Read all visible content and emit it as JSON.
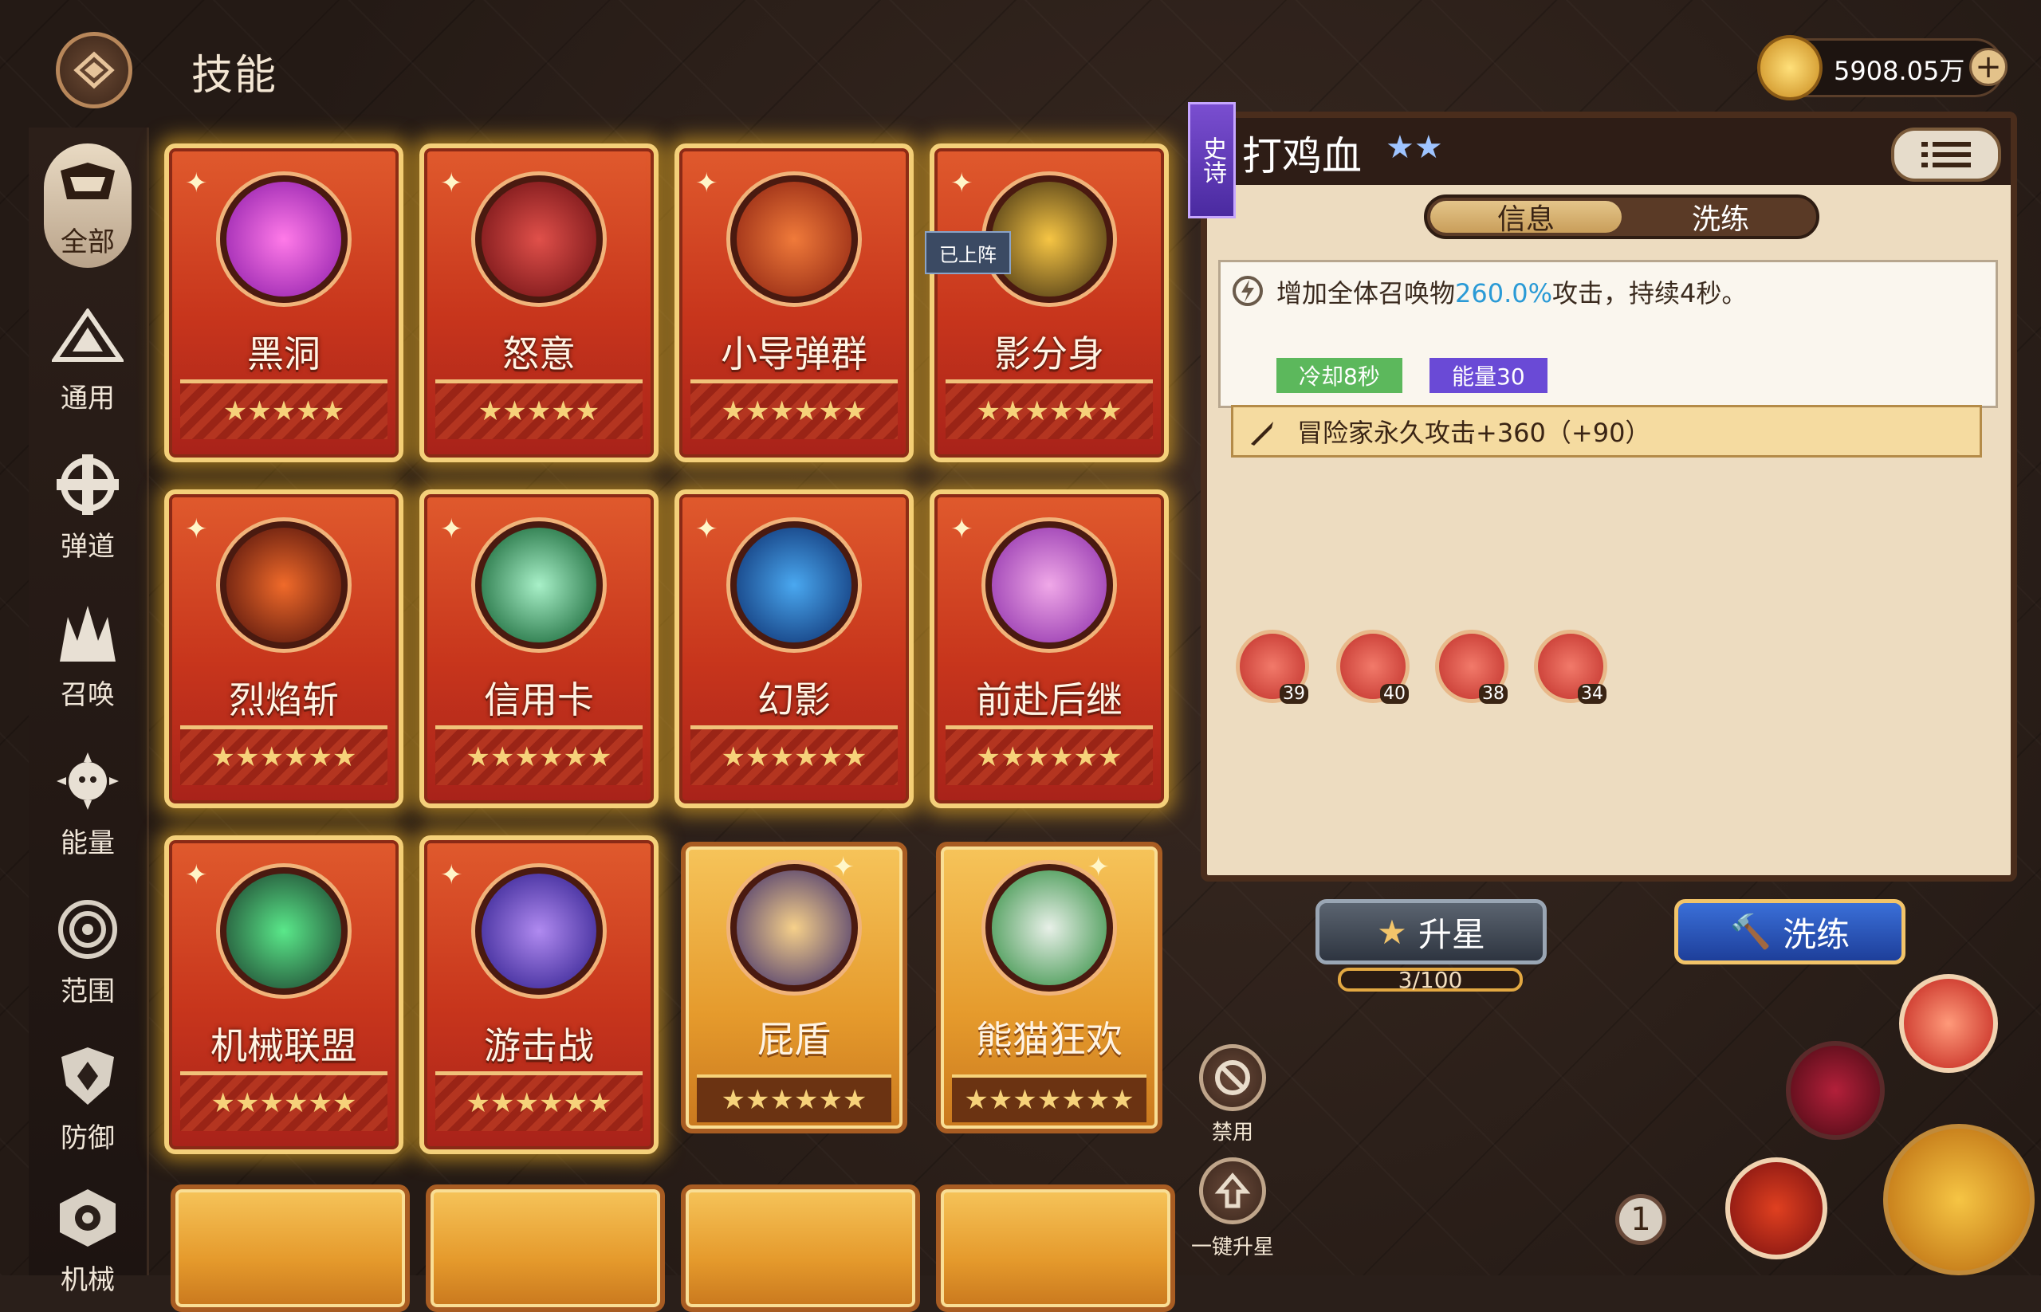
{
  "header": {
    "title": "技能"
  },
  "currency": {
    "value": "5908.05万",
    "plus": "+"
  },
  "sidebar": {
    "items": [
      {
        "label": "全部"
      },
      {
        "label": "通用"
      },
      {
        "label": "弹道"
      },
      {
        "label": "召唤"
      },
      {
        "label": "能量"
      },
      {
        "label": "范围"
      },
      {
        "label": "防御"
      },
      {
        "label": "机械"
      }
    ]
  },
  "cards": [
    {
      "name": "黑洞",
      "stars": "★★★★★",
      "style": "red"
    },
    {
      "name": "怒意",
      "stars": "★★★★★",
      "style": "red"
    },
    {
      "name": "小导弹群",
      "stars": "★★★★★★",
      "style": "red"
    },
    {
      "name": "影分身",
      "stars": "★★★★★★",
      "style": "red"
    },
    {
      "name": "烈焰斩",
      "stars": "★★★★★★",
      "style": "red"
    },
    {
      "name": "信用卡",
      "stars": "★★★★★★",
      "style": "red"
    },
    {
      "name": "幻影",
      "stars": "★★★★★★",
      "style": "red"
    },
    {
      "name": "前赴后继",
      "stars": "★★★★★★",
      "style": "red"
    },
    {
      "name": "机械联盟",
      "stars": "★★★★★★",
      "style": "red"
    },
    {
      "name": "游击战",
      "stars": "★★★★★★",
      "style": "red"
    },
    {
      "name": "屁盾",
      "stars": "★★★★★★",
      "style": "gold"
    },
    {
      "name": "熊猫狂欢",
      "stars": "★★★★★★★",
      "style": "gold"
    }
  ],
  "deployed_tag": "已上阵",
  "detail": {
    "rarity": "史诗",
    "name": "打鸡血",
    "stars": "★★",
    "tabs": [
      {
        "label": "信息"
      },
      {
        "label": "洗练"
      }
    ],
    "desc_prefix": "增加全体召唤物",
    "desc_value": "260.0%",
    "desc_suffix": "攻击，持续4秒。",
    "cooldown": "冷却8秒",
    "energy": "能量30",
    "bonus": "冒险家永久攻击+360（+90）",
    "mini_skills": [
      {
        "level": "39"
      },
      {
        "level": "40"
      },
      {
        "level": "38"
      },
      {
        "level": "34"
      }
    ]
  },
  "actions": {
    "upgrade_label": "升星",
    "upgrade_progress": "3/100",
    "refine_label": "洗练",
    "disable_label": "禁用",
    "auto_upgrade_label": "一键升星",
    "slot_count": "1"
  },
  "colors": {
    "accent_blue": "#2a9ad6",
    "cooldown": "#4caf50",
    "energy": "#6a4ad6"
  }
}
